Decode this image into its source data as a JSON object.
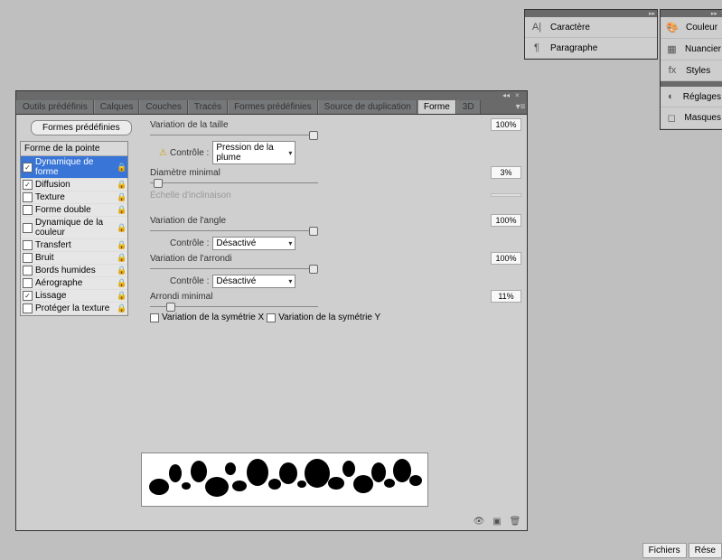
{
  "tabs": [
    "Outils prédéfinis",
    "Calques",
    "Couches",
    "Tracés",
    "Formes prédéfinies",
    "Source de duplication",
    "Forme",
    "3D"
  ],
  "activeTab": "Forme",
  "presetBtn": "Formes prédéfinies",
  "brushHeader": "Forme de la pointe",
  "brushItems": [
    {
      "label": "Dynamique de forme",
      "checked": true,
      "selected": true,
      "locked": true
    },
    {
      "label": "Diffusion",
      "checked": true,
      "locked": true
    },
    {
      "label": "Texture",
      "checked": false,
      "locked": true
    },
    {
      "label": "Forme double",
      "checked": false,
      "locked": true
    },
    {
      "label": "Dynamique de la couleur",
      "checked": false,
      "locked": true
    },
    {
      "label": "Transfert",
      "checked": false,
      "locked": true
    },
    {
      "label": "Bruit",
      "checked": false,
      "locked": true
    },
    {
      "label": "Bords humides",
      "checked": false,
      "locked": true
    },
    {
      "label": "Aérographe",
      "checked": false,
      "locked": true
    },
    {
      "label": "Lissage",
      "checked": true,
      "locked": true
    },
    {
      "label": "Protéger la texture",
      "checked": false,
      "locked": true
    }
  ],
  "controls": {
    "sizeJitter": {
      "label": "Variation de la taille",
      "value": "100%"
    },
    "control1": {
      "label": "Contrôle :",
      "value": "Pression de la plume"
    },
    "minDiam": {
      "label": "Diamètre minimal",
      "value": "3%"
    },
    "tiltScale": {
      "label": "Échelle d'inclinaison",
      "value": ""
    },
    "angleJitter": {
      "label": "Variation de l'angle",
      "value": "100%"
    },
    "control2": {
      "label": "Contrôle :",
      "value": "Désactivé"
    },
    "roundJitter": {
      "label": "Variation de l'arrondi",
      "value": "100%"
    },
    "control3": {
      "label": "Contrôle :",
      "value": "Désactivé"
    },
    "minRound": {
      "label": "Arrondi minimal",
      "value": "11%"
    },
    "symX": "Variation de la symétrie X",
    "symY": "Variation de la symétrie Y"
  },
  "sideLeft": [
    "Caractère",
    "Paragraphe"
  ],
  "sideRight": [
    "Couleur",
    "Nuancier",
    "Styles",
    "Réglages",
    "Masques"
  ],
  "footer": [
    "Fichiers",
    "Rése"
  ]
}
